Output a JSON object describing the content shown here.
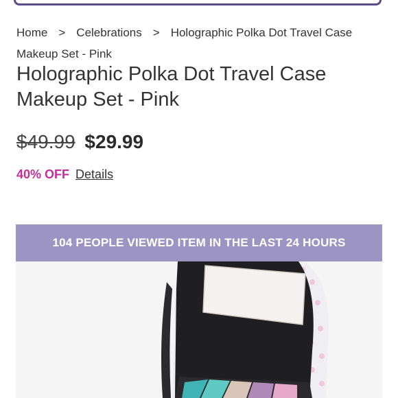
{
  "breadcrumb": {
    "home": "Home",
    "separator_1": ">",
    "category": "Celebrations",
    "separator_2": ">",
    "current": "Holographic Polka Dot Travel Case Makeup Set - Pink"
  },
  "product": {
    "title": "Holographic Polka Dot Travel Case Makeup Set - Pink",
    "price_original": "$49.99",
    "price_sale": "$29.99",
    "discount_label": "40% OFF",
    "details_link": "Details",
    "image_subject": "makeup-case-photo"
  },
  "banner": {
    "viewed_text": "104 PEOPLE VIEWED ITEM IN THE LAST 24 HOURS"
  },
  "colors": {
    "accent_purple": "#5b4a8c",
    "banner_bg": "#9c95c4",
    "discount_pink": "#c22f9b"
  }
}
